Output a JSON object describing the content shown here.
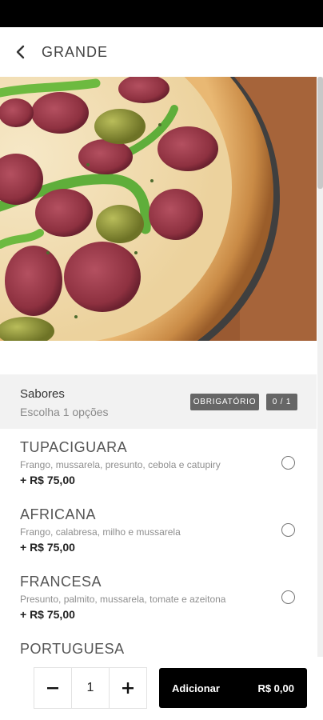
{
  "header": {
    "title": "GRANDE",
    "back_icon": "chevron-left-icon"
  },
  "section": {
    "title": "Sabores",
    "subtitle": "Escolha 1 opções",
    "required_badge": "OBRIGATÓRIO",
    "count_badge": "0 / 1"
  },
  "options": [
    {
      "name": "TUPACIGUARA",
      "description": "Frango, mussarela, presunto, cebola e catupiry",
      "price": "+ R$ 75,00",
      "selected": false
    },
    {
      "name": "AFRICANA",
      "description": "Frango, calabresa, milho e mussarela",
      "price": "+ R$ 75,00",
      "selected": false
    },
    {
      "name": "FRANCESA",
      "description": "Presunto, palmito, mussarela, tomate e azeitona",
      "price": "+ R$ 75,00",
      "selected": false
    },
    {
      "name": "PORTUGUESA",
      "description": "",
      "price": "",
      "selected": false
    }
  ],
  "footer": {
    "quantity": "1",
    "minus_icon": "minus-icon",
    "plus_icon": "plus-icon",
    "add_label": "Adicionar",
    "add_total": "R$ 0,00"
  },
  "colors": {
    "status_bar": "#000000",
    "add_button": "#000000",
    "badge": "#666666",
    "section_bg": "#f2f2f2"
  }
}
